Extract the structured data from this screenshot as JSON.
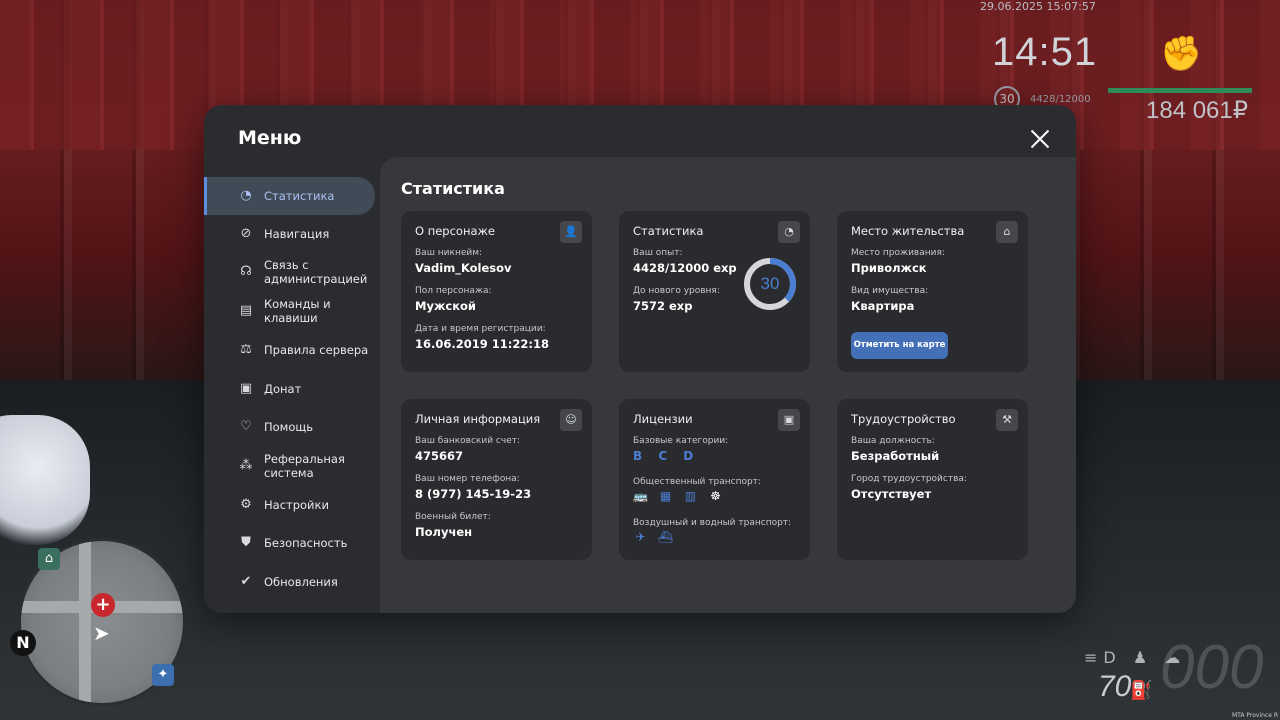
{
  "hud": {
    "datetime": "29.06.2025 15:07:57",
    "clock": "14:51",
    "level": "30",
    "exp": "4428/12000",
    "money": "184 061₽"
  },
  "speedo": {
    "digits": "000",
    "fuel": "70"
  },
  "minimap": {
    "north": "N"
  },
  "corner_text": "MTA Province R",
  "menu": {
    "title": "Меню",
    "close_icon": "close-icon",
    "sidebar": [
      {
        "label": "Статистика",
        "icon": "pie-chart-icon",
        "active": true
      },
      {
        "label": "Навигация",
        "icon": "compass-icon"
      },
      {
        "label": "Связь с администрацией",
        "icon": "headset-icon"
      },
      {
        "label": "Команды и клавиши",
        "icon": "document-icon"
      },
      {
        "label": "Правила сервера",
        "icon": "scales-icon"
      },
      {
        "label": "Донат",
        "icon": "wallet-icon"
      },
      {
        "label": "Помощь",
        "icon": "handshake-icon"
      },
      {
        "label": "Реферальная система",
        "icon": "network-icon"
      },
      {
        "label": "Настройки",
        "icon": "gear-icon"
      },
      {
        "label": "Безопасность",
        "icon": "shield-icon"
      },
      {
        "label": "Обновления",
        "icon": "refresh-check-icon"
      }
    ]
  },
  "stats": {
    "title": "Статистика",
    "character": {
      "title": "О персонаже",
      "nickname_label": "Ваш никнейм:",
      "nickname": "Vadim_Kolesov",
      "gender_label": "Пол персонажа:",
      "gender": "Мужской",
      "reg_label": "Дата и время регистрации:",
      "reg": "16.06.2019 11:22:18"
    },
    "statistics": {
      "title": "Статистика",
      "exp_label": "Ваш опыт:",
      "exp": "4428/12000 exp",
      "next_label": "До нового уровня:",
      "next": "7572 exp",
      "level": "30",
      "progress": 0.369,
      "accent": "#4b7dd1"
    },
    "residence": {
      "title": "Место жительства",
      "place_label": "Место проживания:",
      "place": "Приволжск",
      "property_label": "Вид имущества:",
      "property": "Квартира",
      "map_button": "Отметить на карте"
    },
    "personal": {
      "title": "Личная информация",
      "bank_label": "Ваш банковский счет:",
      "bank": "475667",
      "phone_label": "Ваш номер телефона:",
      "phone": "8 (977) 145-19-23",
      "military_label": "Военный билет:",
      "military": "Получен"
    },
    "licenses": {
      "title": "Лицензии",
      "base_label": "Базовые категории:",
      "base": "B C D",
      "public_label": "Общественный транспорт:",
      "public_icons": [
        "bus-icon",
        "trolleybus-icon",
        "tram-icon",
        "metro-icon"
      ],
      "air_label": "Воздушный и водный транспорт:",
      "air_icons": [
        "plane-icon",
        "boat-icon"
      ]
    },
    "employment": {
      "title": "Трудоустройство",
      "position_label": "Ваша должность:",
      "position": "Безработный",
      "city_label": "Город трудоустройства:",
      "city": "Отсутствует"
    }
  }
}
